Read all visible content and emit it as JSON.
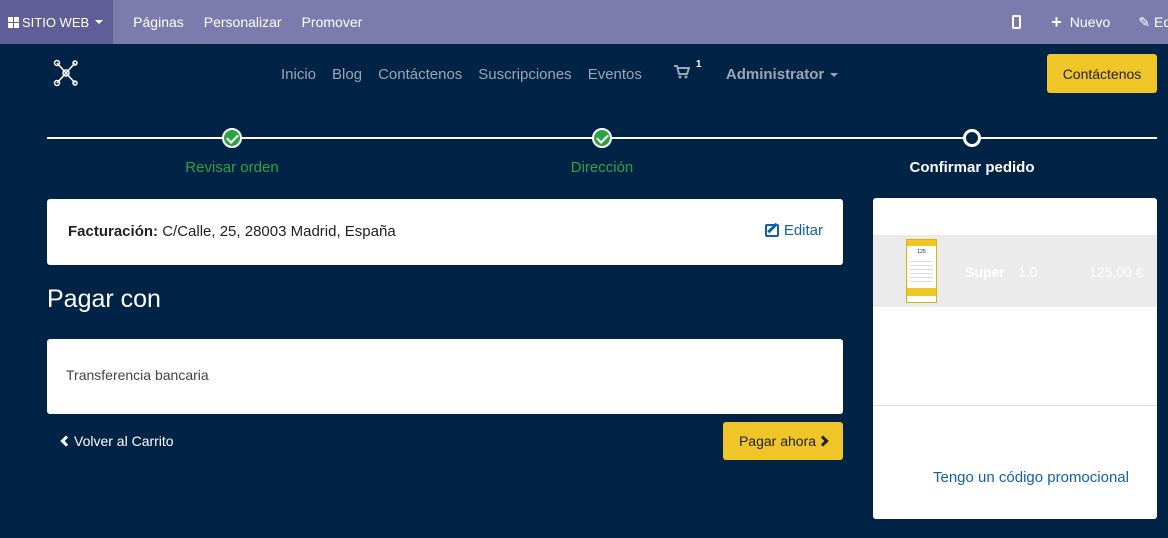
{
  "admin_bar": {
    "site_menu": "SITIO WEB",
    "items": [
      "Páginas",
      "Personalizar",
      "Promover"
    ],
    "new_label": "Nuevo",
    "edit_label": "Editar"
  },
  "header": {
    "nav": [
      "Inicio",
      "Blog",
      "Contáctenos",
      "Suscripciones",
      "Eventos"
    ],
    "cart_count": "1",
    "user": "Administrator",
    "cta": "Contáctenos"
  },
  "progress": {
    "steps": [
      {
        "label": "Revisar orden",
        "state": "done"
      },
      {
        "label": "Dirección",
        "state": "done"
      },
      {
        "label": "Confirmar pedido",
        "state": "current"
      }
    ]
  },
  "billing": {
    "label": "Facturación:",
    "address": "C/Calle, 25, 28003 Madrid, España",
    "edit": "Editar"
  },
  "payment": {
    "title": "Pagar con",
    "method": "Transferencia bancaria",
    "back": "Volver al Carrito",
    "pay_now": "Pagar ahora"
  },
  "summary": {
    "product": {
      "name": "Super",
      "qty": "1.0",
      "price": "125,00 €",
      "thumb_price": "125"
    },
    "promo": "Tengo un código promocional"
  },
  "colors": {
    "admin_bar": "#7C7BAD",
    "background": "#012345",
    "accent": "#F0C528",
    "success": "#2ea244",
    "link": "#1060a8"
  }
}
